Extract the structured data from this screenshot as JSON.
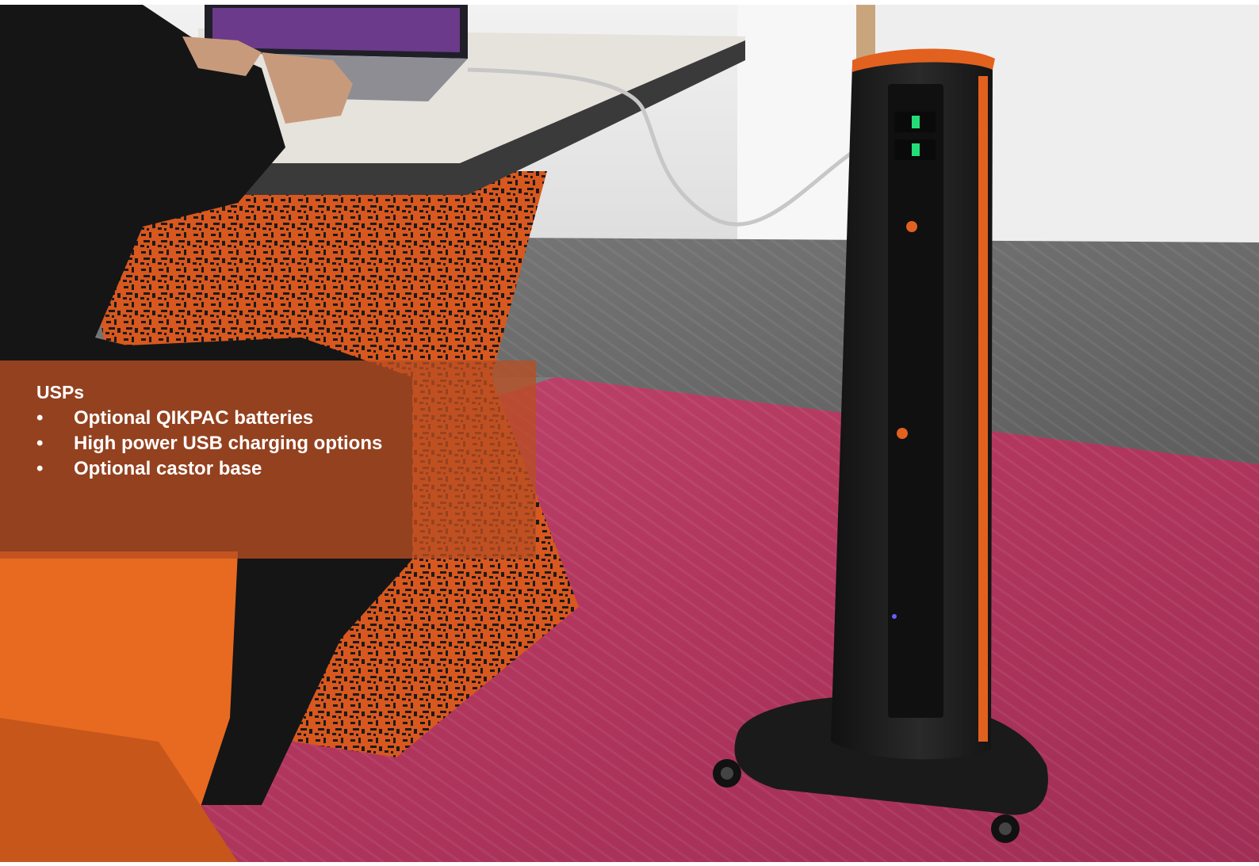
{
  "overlay": {
    "title": "USPs",
    "bullet": "•",
    "items": [
      "Optional QIKPAC batteries",
      "High power USB charging options",
      "Optional castor base"
    ]
  },
  "photo": {
    "subject": "charging-tower",
    "colors": {
      "carpet_magenta": "#b23a64",
      "carpet_grey": "#6e6e6e",
      "wall": "#ececec",
      "tower_body": "#1c1c1c",
      "tower_accent": "#e2611f",
      "overlay": "#b84e22"
    }
  }
}
